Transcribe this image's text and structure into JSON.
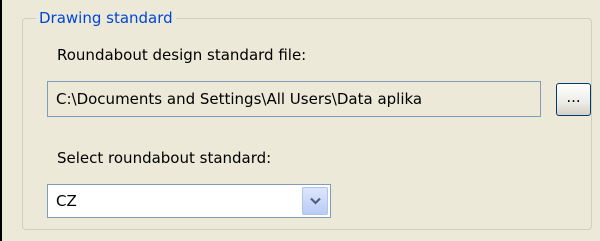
{
  "group": {
    "title": "Drawing standard"
  },
  "file_section": {
    "label": "Roundabout design standard file:",
    "path_value": "C:\\Documents and Settings\\All Users\\Data aplika",
    "browse_label": "..."
  },
  "standard_section": {
    "label": "Select roundabout standard:",
    "selected_value": "CZ",
    "dropdown_icon": "chevron-down-icon"
  },
  "colors": {
    "background": "#ece9d8",
    "group_title": "#0046d5",
    "field_border": "#7f9db9"
  }
}
